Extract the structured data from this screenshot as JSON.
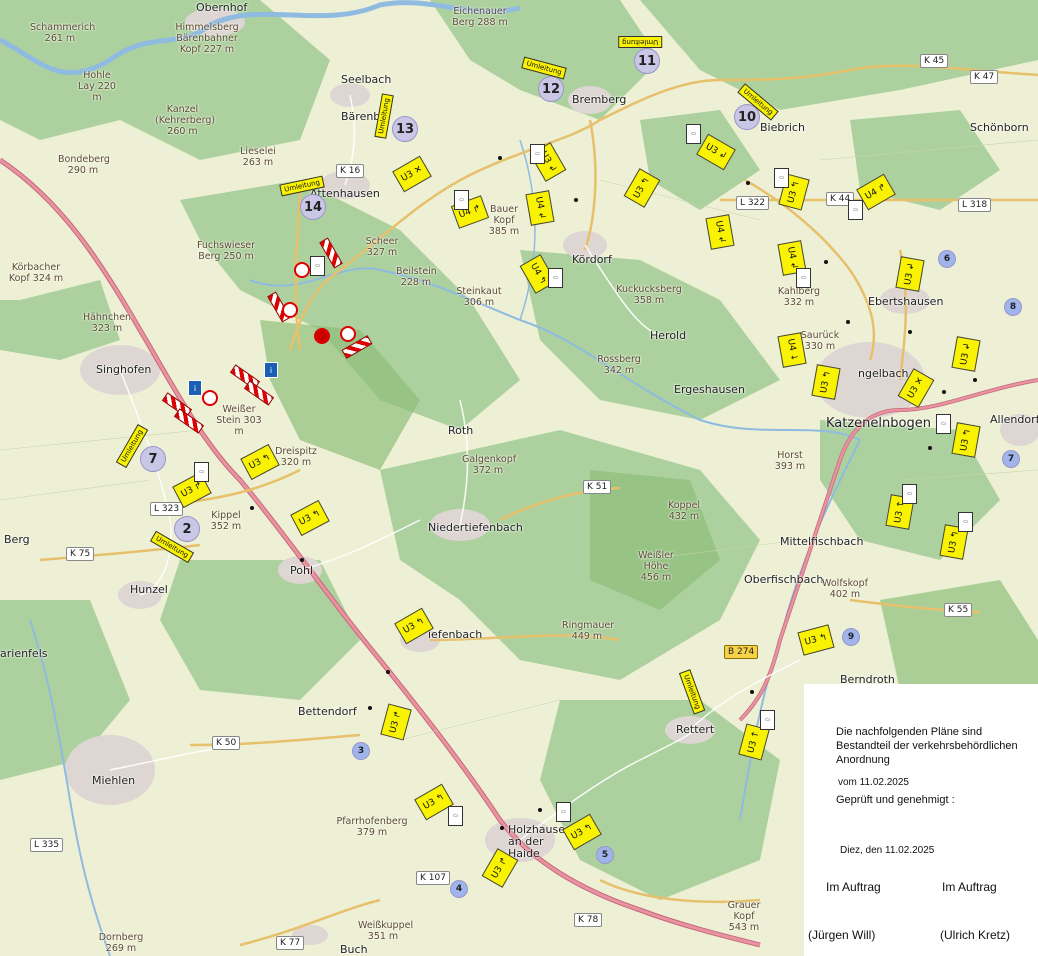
{
  "places": [
    {
      "id": "obernhof",
      "text": "Obernhof"
    },
    {
      "id": "seelbach",
      "text": "Seelbach"
    },
    {
      "id": "baerenbach",
      "text": "Bärenb"
    },
    {
      "id": "bremberg",
      "text": "Bremberg"
    },
    {
      "id": "biebrich",
      "text": "Biebrich"
    },
    {
      "id": "schoenborn",
      "text": "Schönborn"
    },
    {
      "id": "attenhausen",
      "text": "Attenhausen"
    },
    {
      "id": "koerdorf",
      "text": "Kördorf"
    },
    {
      "id": "ebertshausen",
      "text": "Ebertshausen"
    },
    {
      "id": "singhofen",
      "text": "Singhofen"
    },
    {
      "id": "herold",
      "text": "Herold"
    },
    {
      "id": "ergeshausen",
      "text": "Ergeshausen"
    },
    {
      "id": "katzenelnbogen",
      "text": "Katzenelnbogen"
    },
    {
      "id": "allendorf",
      "text": "Allendorf"
    },
    {
      "id": "roth",
      "text": "Roth"
    },
    {
      "id": "niedertiefenbach",
      "text": "Niedertiefenbach"
    },
    {
      "id": "berg",
      "text": "Berg"
    },
    {
      "id": "hunzel",
      "text": "Hunzel"
    },
    {
      "id": "pohl",
      "text": "Pohl"
    },
    {
      "id": "mittelfischbach",
      "text": "Mittelfischbach"
    },
    {
      "id": "oberfischbach",
      "text": "Oberfischbach"
    },
    {
      "id": "obertiefenbach",
      "text": "iefenbach"
    },
    {
      "id": "berndroth",
      "text": "Berndroth"
    },
    {
      "id": "bettendorf",
      "text": "Bettendorf"
    },
    {
      "id": "rettert",
      "text": "Rettert"
    },
    {
      "id": "miehlen",
      "text": "Miehlen"
    },
    {
      "id": "holzhausen",
      "text": "Holzhausen an der Haide"
    },
    {
      "id": "buch",
      "text": "Buch"
    },
    {
      "id": "marienfels",
      "text": "arienfels"
    },
    {
      "id": "ngelbach",
      "text": "ngelbach"
    }
  ],
  "peaks": [
    {
      "text": "Schammerich 261 m"
    },
    {
      "text": "Himmelsberg Bärenbahner Kopf 227 m"
    },
    {
      "text": "Eichenauer Berg 288 m"
    },
    {
      "text": "Hohle Lay 220 m"
    },
    {
      "text": "Kanzel (Kehrerberg) 260 m"
    },
    {
      "text": "Lieselei 263 m"
    },
    {
      "text": "Bondeberg 290 m"
    },
    {
      "text": "Fuchswieser Berg 250 m"
    },
    {
      "text": "Scheer 327 m"
    },
    {
      "text": "Beilstein 228 m"
    },
    {
      "text": "Steinkaut 306 m"
    },
    {
      "text": "Bauer Kopf 385 m"
    },
    {
      "text": "Kuckucksberg 358 m"
    },
    {
      "text": "Kahlberg 332 m"
    },
    {
      "text": "Rossberg 342 m"
    },
    {
      "text": "Körbacher Kopf 324 m"
    },
    {
      "text": "Hähnchen 323 m"
    },
    {
      "text": "Weißer Stein 303 m"
    },
    {
      "text": "Dreispitz 320 m"
    },
    {
      "text": "Kippel 352 m"
    },
    {
      "text": "Galgenkopf 372 m"
    },
    {
      "text": "Horst 393 m"
    },
    {
      "text": "Koppel 432 m"
    },
    {
      "text": "Weißler Höhe 456 m"
    },
    {
      "text": "Wolfskopf 402 m"
    },
    {
      "text": "Ringmauer 449 m"
    },
    {
      "text": "Pfarrhofenberg 379 m"
    },
    {
      "text": "Weißkuppel 351 m"
    },
    {
      "text": "Grauer Kopf 543 m"
    },
    {
      "text": "Dornberg 269 m"
    },
    {
      "text": "Saurück 330 m"
    }
  ],
  "roads": [
    "K 45",
    "K 47",
    "K 16",
    "L 322",
    "K 44",
    "L 318",
    "L 323",
    "K 75",
    "K 51",
    "K 55",
    "B 274",
    "K 50",
    "L 335",
    "K 107",
    "K 78",
    "K 77"
  ],
  "route_numbers": [
    "2",
    "7",
    "10",
    "11",
    "12",
    "13",
    "14",
    "3",
    "4",
    "5",
    "6",
    "7",
    "8",
    "9"
  ],
  "detour_label": "Umleitung",
  "panel": {
    "line1": "Die nachfolgenden Pläne sind",
    "line2": "Bestandteil der verkehrsbehördlichen",
    "line3": "Anordnung",
    "date_line": "vom 11.02.2025",
    "approved": "Geprüft und genehmigt :",
    "place_date": "Diez, den 11.02.2025",
    "left_role": "Im Auftrag",
    "right_role": "Im Auftrag",
    "left_name": "(Jürgen Will)",
    "right_name": "(Ulrich Kretz)"
  },
  "colors": {
    "forest": "#add19e",
    "field": "#eef0d5",
    "water": "#aad3df",
    "road": "#f7fabf",
    "main_road": "#d77f8a",
    "sign": "#f9f200"
  }
}
